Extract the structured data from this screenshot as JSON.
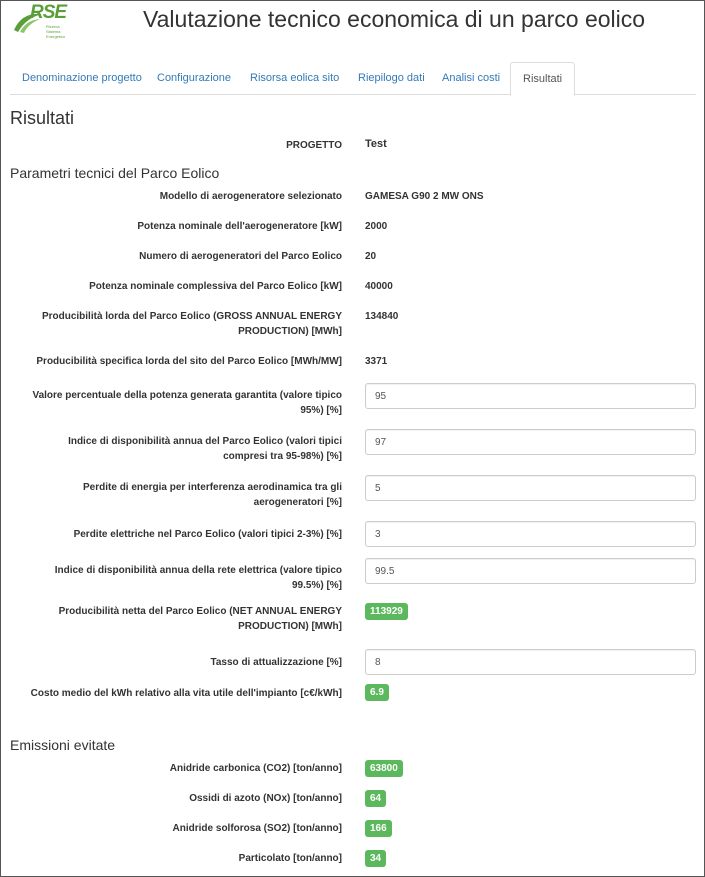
{
  "logo": {
    "text": "RSE",
    "subtitle": "Ricerca Sistema Energetico"
  },
  "app_title": "Valutazione tecnico economica di un parco eolico",
  "tabs": [
    {
      "label": "Denominazione progetto"
    },
    {
      "label": "Configurazione"
    },
    {
      "label": "Risorsa eolica sito"
    },
    {
      "label": "Riepilogo dati"
    },
    {
      "label": "Analisi costi"
    },
    {
      "label": "Risultati"
    }
  ],
  "active_tab": "Risultati",
  "page_title": "Risultati",
  "project": {
    "label": "PROGETTO",
    "value": "Test"
  },
  "technical": {
    "title": "Parametri tecnici del Parco Eolico",
    "rows": [
      {
        "label": "Modello di aerogeneratore selezionato",
        "value": "GAMESA G90 2 MW ONS"
      },
      {
        "label": "Potenza nominale dell'aerogeneratore [kW]",
        "value": "2000"
      },
      {
        "label": "Numero di aerogeneratori del Parco Eolico",
        "value": "20"
      },
      {
        "label": "Potenza nominale complessiva del Parco Eolico [kW]",
        "value": "40000"
      },
      {
        "label": "Producibilità lorda del Parco Eolico (GROSS ANNUAL ENERGY PRODUCTION) [MWh]",
        "value": "134840"
      },
      {
        "label": "Producibilità specifica lorda del sito del Parco Eolico [MWh/MW]",
        "value": "3371"
      }
    ],
    "inputs": [
      {
        "label": "Valore percentuale della potenza generata garantita (valore tipico 95%) [%]",
        "value": "95"
      },
      {
        "label": "Indice di disponibilità annua del Parco Eolico (valori tipici compresi tra 95-98%) [%]",
        "value": "97"
      },
      {
        "label": "Perdite di energia per interferenza aerodinamica tra gli aerogeneratori [%]",
        "value": "5"
      },
      {
        "label": "Perdite elettriche nel Parco Eolico (valori tipici 2-3%) [%]",
        "value": "3"
      },
      {
        "label": "Indice di disponibilità annua della rete elettrica (valore tipico 99.5%) [%]",
        "value": "99.5"
      }
    ],
    "net_production": {
      "label": "Producibilità netta del Parco Eolico (NET ANNUAL ENERGY PRODUCTION) [MWh]",
      "value": "113929"
    },
    "discount_rate": {
      "label": "Tasso di attualizzazione [%]",
      "value": "8"
    },
    "lcoe": {
      "label": "Costo medio del kWh relativo alla vita utile dell'impianto [c€/kWh]",
      "value": "6.9"
    }
  },
  "emissions": {
    "title": "Emissioni evitate",
    "rows": [
      {
        "label": "Anidride carbonica (CO2) [ton/anno]",
        "value": "63800"
      },
      {
        "label": "Ossidi di azoto (NOx) [ton/anno]",
        "value": "64"
      },
      {
        "label": "Anidride solforosa (SO2) [ton/anno]",
        "value": "166"
      },
      {
        "label": "Particolato [ton/anno]",
        "value": "34"
      }
    ]
  },
  "colors": {
    "badge": "#5cb85c",
    "link": "#337ab7",
    "logo": "#5a9e3a"
  }
}
